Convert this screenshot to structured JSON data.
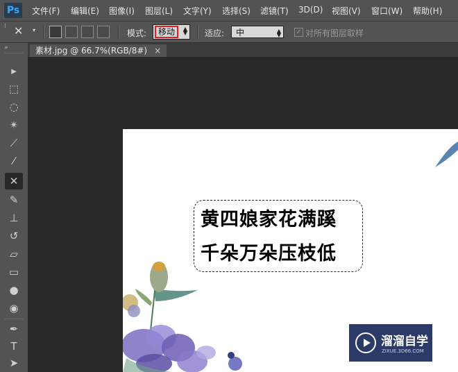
{
  "app": {
    "logo": "Ps"
  },
  "menu": [
    "文件(F)",
    "编辑(E)",
    "图像(I)",
    "图层(L)",
    "文字(Y)",
    "选择(S)",
    "滤镜(T)",
    "3D(D)",
    "视图(V)",
    "窗口(W)",
    "帮助(H)"
  ],
  "options": {
    "mode_label": "模式:",
    "mode_value": "移动",
    "adapt_label": "适应:",
    "adapt_value": "中",
    "sample_all_layers": "对所有图层取样",
    "sample_checked": true
  },
  "document": {
    "tab_title": "素材.jpg @ 66.7%(RGB/8#)",
    "close_glyph": "×"
  },
  "canvas_text": {
    "line1": "黄四娘家花满蹊",
    "line2": "千朵万朵压枝低"
  },
  "watermark": {
    "title": "溜溜自学",
    "subtitle": "ZIXUE.3D66.COM"
  },
  "tools": [
    {
      "name": "move-tool-icon",
      "glyph": "▸✛"
    },
    {
      "name": "marquee-tool-icon",
      "glyph": "⬚"
    },
    {
      "name": "lasso-tool-icon",
      "glyph": "◌"
    },
    {
      "name": "magic-wand-tool-icon",
      "glyph": "✴"
    },
    {
      "name": "crop-tool-icon",
      "glyph": "⟋"
    },
    {
      "name": "eyedropper-tool-icon",
      "glyph": "⁄"
    },
    {
      "name": "content-aware-move-tool-icon",
      "glyph": "✕"
    },
    {
      "name": "brush-tool-icon",
      "glyph": "✎"
    },
    {
      "name": "clone-stamp-tool-icon",
      "glyph": "⊥"
    },
    {
      "name": "history-brush-tool-icon",
      "glyph": "↺"
    },
    {
      "name": "eraser-tool-icon",
      "glyph": "▱"
    },
    {
      "name": "gradient-tool-icon",
      "glyph": "▭"
    },
    {
      "name": "blur-tool-icon",
      "glyph": "💧"
    },
    {
      "name": "dodge-tool-icon",
      "glyph": "●"
    },
    {
      "name": "pen-tool-icon",
      "glyph": "✒"
    },
    {
      "name": "type-tool-icon",
      "glyph": "T"
    },
    {
      "name": "path-selection-tool-icon",
      "glyph": "➤"
    }
  ]
}
